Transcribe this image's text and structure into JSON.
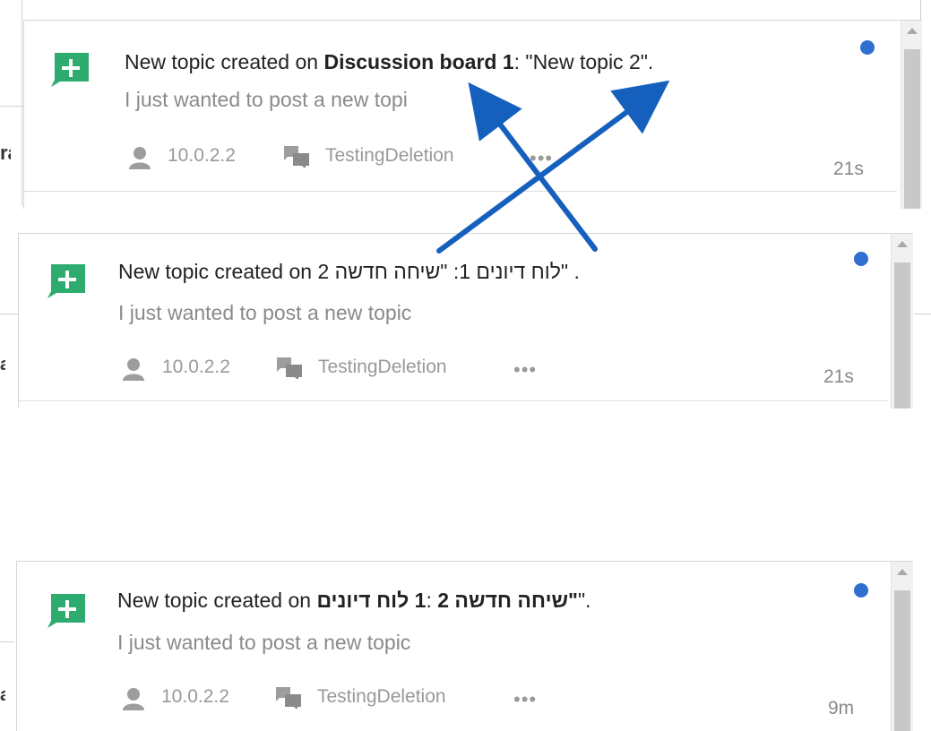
{
  "colors": {
    "accent_green": "#2eab6f",
    "unread_blue": "#2f6fcf",
    "annotation_arrow": "#1560bd"
  },
  "edge_fragments": [
    "ra",
    "a",
    "a"
  ],
  "panels": [
    {
      "title_prefix": "New topic created on ",
      "title_board": "Discussion board 1",
      "title_sep": ": ",
      "title_topic": "\"New topic 2\".",
      "excerpt": "I just wanted to post a new topi",
      "user": "10.0.2.2",
      "board": "TestingDeletion",
      "more": "•••",
      "time": "21s"
    },
    {
      "title_prefix": "New topic created on ",
      "title_rtl_mixed": "\"לוח דיונים 1: \"שיחה חדשה 2",
      "title_suffix": " .",
      "excerpt": "I just wanted to post a new topic",
      "user": "10.0.2.2",
      "board": "TestingDeletion",
      "more": "•••",
      "time": "21s"
    },
    {
      "title_prefix": "New topic created on ",
      "title_board": "1 לוח דיונים",
      "title_sep": ": ",
      "title_topic_bold": "\"שיחה חדשה 2",
      "title_topic_end": "\".",
      "excerpt": "I just wanted to post a new topic",
      "user": "10.0.2.2",
      "board": "TestingDeletion",
      "more": "•••",
      "time": "9m"
    }
  ],
  "icons": {
    "new_topic": "plus-chat-icon",
    "user": "person-icon",
    "board": "chat-bubbles-icon",
    "more": "more-dots-icon"
  }
}
